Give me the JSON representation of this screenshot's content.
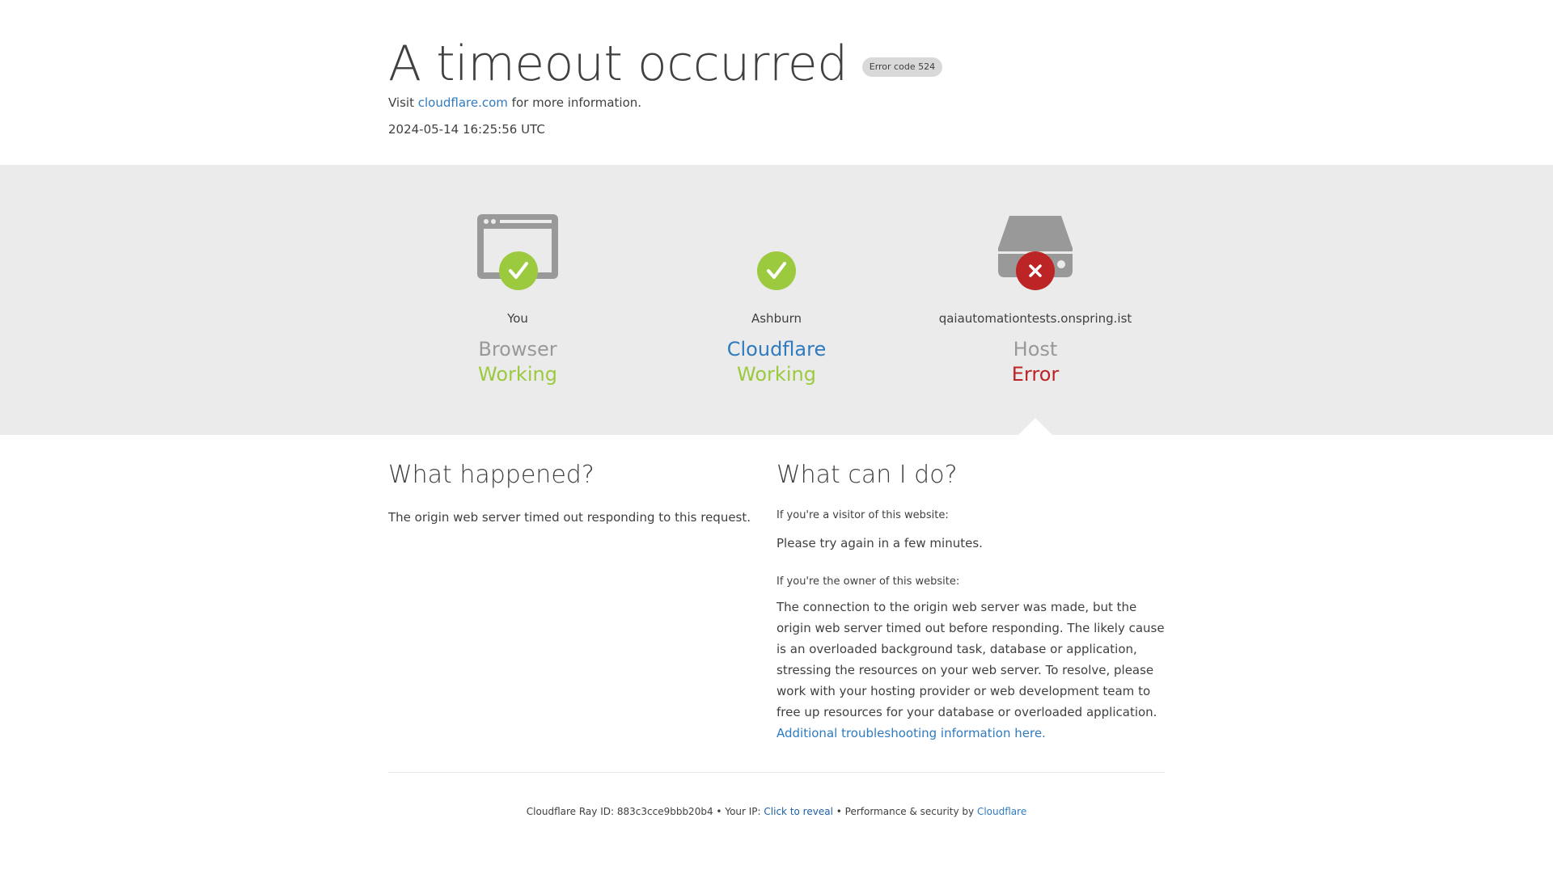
{
  "header": {
    "title": "A timeout occurred",
    "error_badge": "Error code 524",
    "visit_prefix": "Visit",
    "visit_link": "cloudflare.com",
    "visit_suffix": "for more information.",
    "timestamp": "2024-05-14 16:25:56 UTC"
  },
  "status": [
    {
      "place": "You",
      "role": "Browser",
      "state": "Working",
      "icon": "browser-icon",
      "badge": "check-icon"
    },
    {
      "place": "Ashburn",
      "role": "Cloudflare",
      "state": "Working",
      "icon": "cloud-icon",
      "badge": "check-icon"
    },
    {
      "place": "qaiautomationtests.onspring.ist",
      "role": "Host",
      "state": "Error",
      "icon": "server-icon",
      "badge": "close-icon"
    }
  ],
  "colors": {
    "ok": "#9bca3e",
    "error": "#bd2426",
    "link": "#2f7bbf",
    "icon_gray": "#999999"
  },
  "what_happened": {
    "heading": "What happened?",
    "body": "The origin web server timed out responding to this request."
  },
  "what_can_i_do": {
    "heading": "What can I do?",
    "visitor_label": "If you're a visitor of this website:",
    "visitor_body": "Please try again in a few minutes.",
    "owner_label": "If you're the owner of this website:",
    "owner_body": "The connection to the origin web server was made, but the origin web server timed out before responding. The likely cause is an overloaded background task, database or application, stressing the resources on your web server. To resolve, please work with your hosting provider or web development team to free up resources for your database or overloaded application.",
    "owner_link": "Additional troubleshooting information here."
  },
  "footer": {
    "ray_label": "Cloudflare Ray ID:",
    "ray_id": "883c3cce9bbb20b4",
    "ip_label": "Your IP:",
    "ip_link": "Click to reveal",
    "perf_label": "Performance & security by",
    "perf_link": "Cloudflare",
    "separator": "•"
  }
}
